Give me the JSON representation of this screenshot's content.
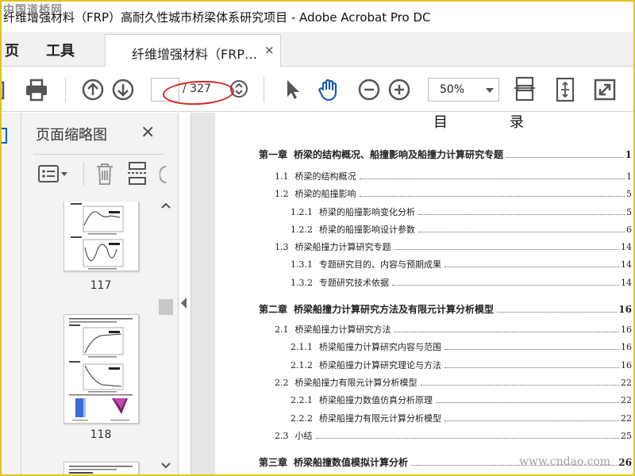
{
  "window": {
    "title": "纤维增强材料（FRP）高耐久性城市桥梁体系研究项目 - Adobe Acrobat Pro DC",
    "watermark_top": "中国道桥网"
  },
  "menu": {
    "home_partial": "页",
    "tools": "工具"
  },
  "tab": {
    "label": "纤维增强材料（FRP…",
    "close": "×"
  },
  "toolbar": {
    "page_current": "",
    "page_total": "/ 327",
    "zoom": "50%",
    "icons": [
      "print-icon",
      "prev-page-icon",
      "next-page-icon",
      "page-navigation-icon",
      "select-cursor-icon",
      "hand-tool-icon",
      "zoom-out-icon",
      "zoom-in-icon",
      "fit-width-icon",
      "fit-page-icon",
      "fullscreen-icon"
    ],
    "accent": "#1a5fb4"
  },
  "thumbnails_panel": {
    "title": "页面缩略图",
    "close": "×",
    "pages": [
      {
        "number": "117"
      },
      {
        "number": "118"
      }
    ]
  },
  "document": {
    "toc_title": "目　录",
    "toc": [
      {
        "level": "chapter",
        "num": "第一章",
        "label": "桥梁的结构概况、船撞影响及船撞力计算研究专题",
        "page": "1"
      },
      {
        "level": "section",
        "num": "1.1",
        "label": "桥梁的结构概况",
        "page": "1"
      },
      {
        "level": "section",
        "num": "1.2",
        "label": "桥梁的船撞影响",
        "page": "5"
      },
      {
        "level": "sub",
        "num": "1.2.1",
        "label": "桥梁的船撞影响变化分析",
        "page": "5"
      },
      {
        "level": "sub",
        "num": "1.2.2",
        "label": "桥梁的船撞影响设计参数",
        "page": "6"
      },
      {
        "level": "section",
        "num": "1.3",
        "label": "桥梁船撞力计算研究专题",
        "page": "14"
      },
      {
        "level": "sub",
        "num": "1.3.1",
        "label": "专题研究目的、内容与预期成果",
        "page": "14"
      },
      {
        "level": "sub",
        "num": "1.3.2",
        "label": "专题研究技术依据",
        "page": "14"
      },
      {
        "level": "chapter",
        "num": "第二章",
        "label": "桥梁船撞力计算研究方法及有限元计算分析模型",
        "page": "16"
      },
      {
        "level": "section",
        "num": "2.1",
        "label": "桥梁船撞力计算研究方法",
        "page": "16"
      },
      {
        "level": "sub",
        "num": "2.1.1",
        "label": "桥梁船撞力计算研究内容与范围",
        "page": "16"
      },
      {
        "level": "sub",
        "num": "2.1.2",
        "label": "桥梁船撞力计算研究理论与方法",
        "page": "16"
      },
      {
        "level": "section",
        "num": "2.2",
        "label": "桥梁船撞力有限元计算分析模型",
        "page": "22"
      },
      {
        "level": "sub",
        "num": "2.2.1",
        "label": "桥梁船撞力数值仿真分析原理",
        "page": "22"
      },
      {
        "level": "sub",
        "num": "2.2.2",
        "label": "桥梁船撞力有限元计算分析模型",
        "page": "22"
      },
      {
        "level": "section",
        "num": "2.3",
        "label": "小结",
        "page": "25"
      },
      {
        "level": "chapter",
        "num": "第三章",
        "label": "桥梁船撞数值模拟计算分析",
        "page": "26"
      }
    ],
    "watermark_bottom": "www.cndao.com"
  }
}
